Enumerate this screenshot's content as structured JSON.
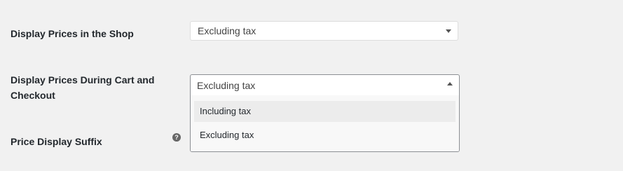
{
  "settings": {
    "shop_prices": {
      "label": "Display Prices in the Shop",
      "value": "Excluding tax"
    },
    "cart_prices": {
      "label_line1": "Display Prices During Cart and",
      "label_line2": "Checkout",
      "value": "Excluding tax",
      "options": [
        "Including tax",
        "Excluding tax"
      ],
      "expanded": true
    },
    "price_suffix": {
      "label": "Price Display Suffix",
      "help_icon": "question-circle-icon",
      "help_glyph": "?"
    }
  }
}
